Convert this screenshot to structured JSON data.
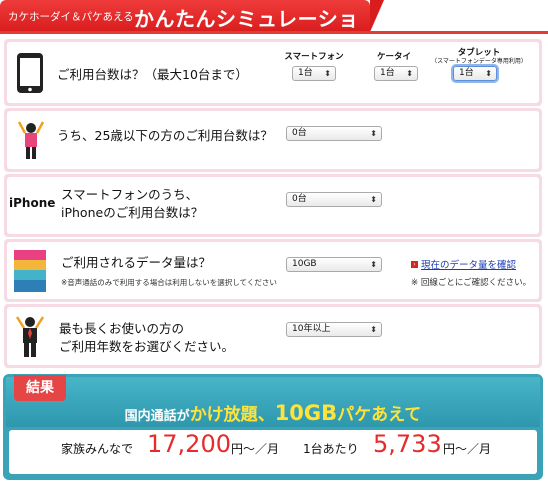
{
  "header": {
    "subtitle": "カケホーダイ＆パケあえる",
    "title": "かんたんシミュレーション"
  },
  "q1": {
    "question": "ご利用台数は？（最大10台まで）",
    "cols": [
      {
        "head": "スマートフォン",
        "sub": "",
        "value": "1台"
      },
      {
        "head": "ケータイ",
        "sub": "",
        "value": "1台"
      },
      {
        "head": "タブレット",
        "sub": "（スマートフォンデータ専用利用）",
        "value": "1台"
      }
    ]
  },
  "q2": {
    "question": "うち、25歳以下の方のご利用台数は？",
    "value": "0台"
  },
  "q3": {
    "icon_label": "iPhone",
    "question_line1": "スマートフォンのうち、",
    "question_line2": "iPhoneのご利用台数は？",
    "value": "0台"
  },
  "q4": {
    "question": "ご利用されるデータ量は？",
    "note": "※音声通話のみで利用する場合は利用しないを選択してください",
    "value": "10GB",
    "link": "現在のデータ量を確認",
    "link_note": "※ 回線ごとにご確認ください。"
  },
  "q5": {
    "question_line1": "最も長くお使いの方の",
    "question_line2": "ご利用年数をお選びください。",
    "value": "10年以上"
  },
  "result": {
    "tag": "結果",
    "line_a": "国内通話が",
    "line_b": "かけ放題",
    "line_c": "、",
    "line_d": "10GB",
    "line_e": "パケあえて",
    "family_label": "家族みんなで",
    "family_price": "17,200",
    "family_unit": "円〜／月",
    "per_label": "1台あたり",
    "per_price": "5,733",
    "per_unit": "円〜／月"
  },
  "colors": {
    "accent_red": "#e53a3a",
    "teal": "#3aa3b8",
    "pink": "#f6dbe4",
    "price_red": "#e52b2b",
    "yellow": "#ffe33a"
  },
  "icons": [
    "smartphone-icon",
    "person-cheer-icon",
    "data-bars-icon",
    "person-suit-icon"
  ]
}
